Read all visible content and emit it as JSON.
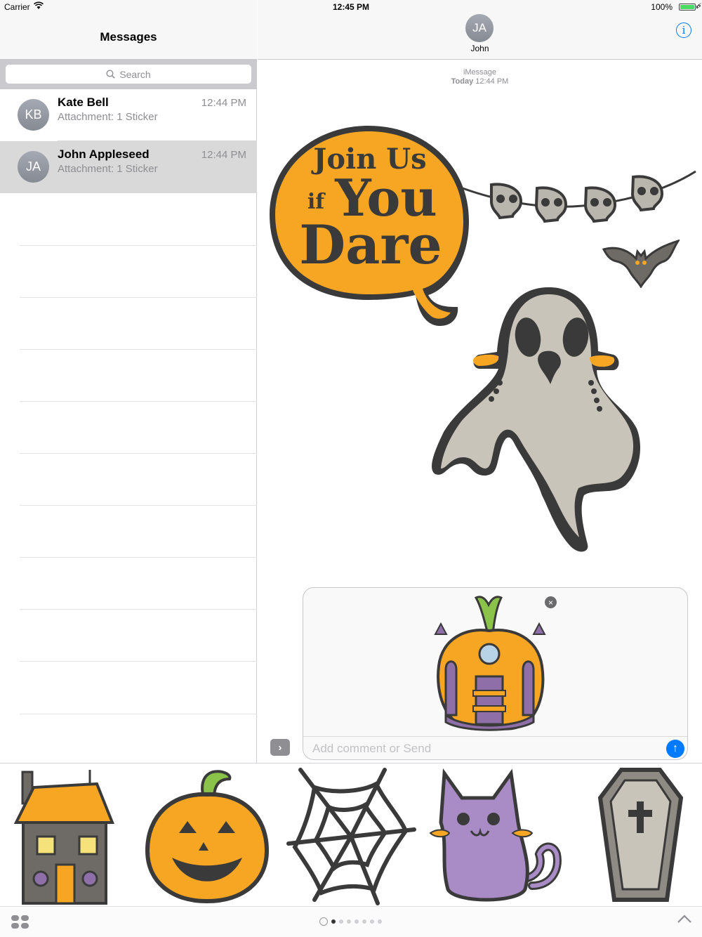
{
  "status_bar": {
    "carrier": "Carrier",
    "time": "12:45 PM",
    "battery": "100%"
  },
  "left": {
    "title": "Messages",
    "search_placeholder": "Search",
    "conversations": [
      {
        "initials": "KB",
        "name": "Kate Bell",
        "preview": "Attachment: 1 Sticker",
        "time": "12:44 PM"
      },
      {
        "initials": "JA",
        "name": "John Appleseed",
        "preview": "Attachment: 1 Sticker",
        "time": "12:44 PM"
      }
    ]
  },
  "right": {
    "initials": "JA",
    "contact_name": "John",
    "service_label": "iMessage",
    "date_prefix": "Today",
    "date_time": "12:44 PM"
  },
  "stickers": {
    "speech_line1": "Join Us",
    "speech_if": "if",
    "speech_you": "You",
    "speech_dare": "Dare"
  },
  "compose": {
    "placeholder": "Add comment or Send"
  },
  "drawer": {
    "items": [
      "haunted-house-sticker",
      "jack-o-lantern-sticker",
      "spider-web-sticker",
      "purple-cat-sticker",
      "coffin-sticker"
    ]
  },
  "colors": {
    "accent": "#007aff",
    "orange": "#f6a623",
    "dark": "#3a3a3a"
  }
}
